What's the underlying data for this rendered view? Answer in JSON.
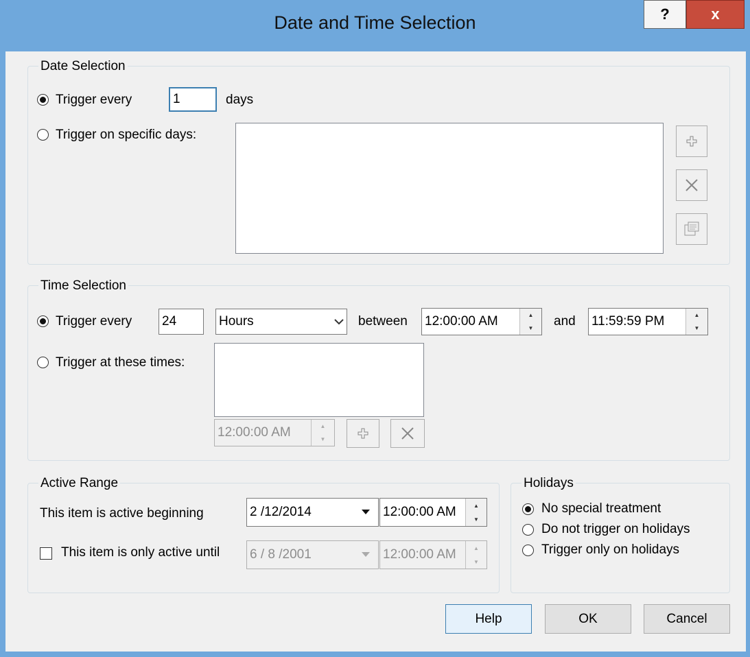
{
  "window": {
    "title": "Date and Time Selection",
    "help_glyph": "?",
    "close_glyph": "x"
  },
  "date_selection": {
    "legend": "Date Selection",
    "trigger_every_label": "Trigger every",
    "trigger_every_value": "1",
    "days_label": "days",
    "specific_days_label": "Trigger on specific days:",
    "selected_option": "trigger_every"
  },
  "time_selection": {
    "legend": "Time Selection",
    "trigger_every_label": "Trigger every",
    "interval_value": "24",
    "unit_value": "Hours",
    "between_label": "between",
    "start_time": "12:00:00 AM",
    "and_label": "and",
    "end_time": "11:59:59 PM",
    "at_times_label": "Trigger at these times:",
    "time_entry_value": "12:00:00 AM",
    "selected_option": "trigger_every"
  },
  "active_range": {
    "legend": "Active Range",
    "beginning_label": "This item is active beginning",
    "begin_date": "2 /12/2014",
    "begin_time": "12:00:00 AM",
    "until_label": "This item is only active until",
    "until_checked": false,
    "until_date": "6 / 8 /2001",
    "until_time": "12:00:00 AM"
  },
  "holidays": {
    "legend": "Holidays",
    "options": [
      {
        "label": "No special treatment",
        "selected": true
      },
      {
        "label": "Do not trigger on holidays",
        "selected": false
      },
      {
        "label": "Trigger only on holidays",
        "selected": false
      }
    ]
  },
  "buttons": {
    "help": "Help",
    "ok": "OK",
    "cancel": "Cancel"
  },
  "icons": {
    "add": "plus-icon",
    "delete": "x-icon",
    "properties": "properties-icon"
  }
}
